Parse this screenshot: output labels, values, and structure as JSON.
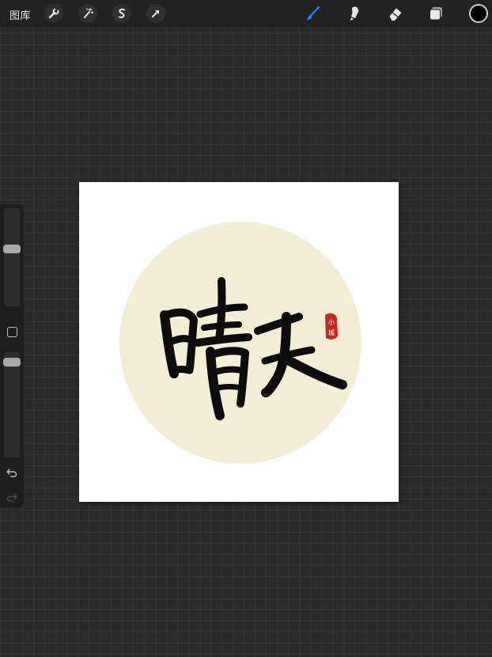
{
  "topbar": {
    "gallery_label": "图库",
    "icons": {
      "actions": "wrench-icon",
      "adjustments": "magic-wand-icon",
      "selection": "selection-s-icon",
      "transform": "arrow-cursor-icon",
      "brush": "brush-icon",
      "smudge": "smudge-icon",
      "eraser": "eraser-icon",
      "layers": "layers-icon"
    },
    "active_tool": "brush",
    "accent_color": "#1e88ff",
    "current_color": "#000000"
  },
  "sidebar": {
    "brush_size_level": 0.4,
    "opacity_level": 0.1,
    "icons": {
      "modifier": "square-modifier-icon",
      "undo": "undo-icon",
      "redo": "redo-icon"
    }
  },
  "artwork": {
    "calligraphy_text": "晴天",
    "seal_text": "小城",
    "circle_color": "#f3eed5",
    "seal_color": "#c4291d"
  }
}
